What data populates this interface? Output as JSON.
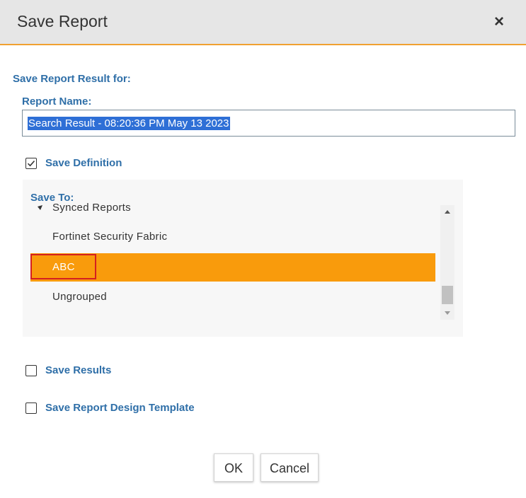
{
  "dialog": {
    "title": "Save Report",
    "close_glyph": "×"
  },
  "form": {
    "section_title": "Save Report Result for:",
    "report_name_label": "Report Name:",
    "report_name_value": "Search Result - 08:20:36 PM May 13 2023",
    "save_definition": {
      "label": "Save Definition",
      "checked": true
    },
    "save_to_label": "Save To:",
    "save_to_items": [
      {
        "label": "Synced Reports",
        "expandable": true,
        "selected": false
      },
      {
        "label": "Fortinet Security Fabric",
        "selected": false
      },
      {
        "label": "ABC",
        "selected": true
      },
      {
        "label": "Ungrouped",
        "selected": false
      }
    ],
    "save_results": {
      "label": "Save Results",
      "checked": false
    },
    "save_template": {
      "label": "Save Report Design Template",
      "checked": false
    }
  },
  "buttons": {
    "ok": "OK",
    "cancel": "Cancel"
  },
  "colors": {
    "accent_orange": "#f99b0c",
    "label_blue": "#2f6fa8",
    "highlight_red": "#d42020",
    "selection_blue": "#2e6fd6"
  },
  "icons": {
    "close": "close-icon",
    "check": "checkmark-icon",
    "expand": "caret-right-icon",
    "scroll_up": "arrow-up-icon",
    "scroll_down": "arrow-down-icon"
  }
}
